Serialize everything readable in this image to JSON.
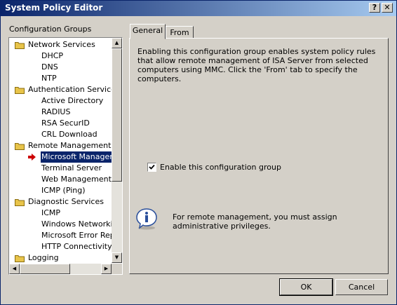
{
  "window": {
    "title": "System Policy Editor",
    "help_glyph": "?",
    "close_glyph": "✕"
  },
  "sidebar": {
    "label": "Configuration Groups",
    "items": [
      {
        "label": "Network Services",
        "kind": "folder"
      },
      {
        "label": "DHCP",
        "kind": "child"
      },
      {
        "label": "DNS",
        "kind": "child"
      },
      {
        "label": "NTP",
        "kind": "child"
      },
      {
        "label": "Authentication Services",
        "kind": "folder"
      },
      {
        "label": "Active Directory",
        "kind": "child"
      },
      {
        "label": "RADIUS",
        "kind": "child"
      },
      {
        "label": "RSA SecurID",
        "kind": "child"
      },
      {
        "label": "CRL Download",
        "kind": "child"
      },
      {
        "label": "Remote Management",
        "kind": "folder"
      },
      {
        "label": "Microsoft Manageme",
        "kind": "child",
        "selected": true
      },
      {
        "label": "Terminal Server",
        "kind": "child"
      },
      {
        "label": "Web Management",
        "kind": "child"
      },
      {
        "label": "ICMP (Ping)",
        "kind": "child"
      },
      {
        "label": "Diagnostic Services",
        "kind": "folder"
      },
      {
        "label": "ICMP",
        "kind": "child"
      },
      {
        "label": "Windows Networking",
        "kind": "child"
      },
      {
        "label": "Microsoft Error Repo",
        "kind": "child"
      },
      {
        "label": "HTTP Connectivity ve",
        "kind": "child"
      },
      {
        "label": "Logging",
        "kind": "folder"
      }
    ]
  },
  "tabs": [
    {
      "label": "General",
      "active": true
    },
    {
      "label": "From",
      "active": false
    }
  ],
  "general": {
    "description": "Enabling this configuration group enables system policy rules that allow remote management of ISA Server from selected computers using MMC. Click the 'From' tab to specify the computers.",
    "enable_checkbox": {
      "label": "Enable this configuration group",
      "checked": true
    },
    "info_text": "For remote management, you must assign administrative privileges."
  },
  "buttons": {
    "ok": "OK",
    "cancel": "Cancel"
  },
  "colors": {
    "titlebar_start": "#0a246a",
    "titlebar_end": "#a6caf0",
    "selection": "#0a246a",
    "folder": "#e8c44a",
    "arrow": "#cc0000"
  }
}
